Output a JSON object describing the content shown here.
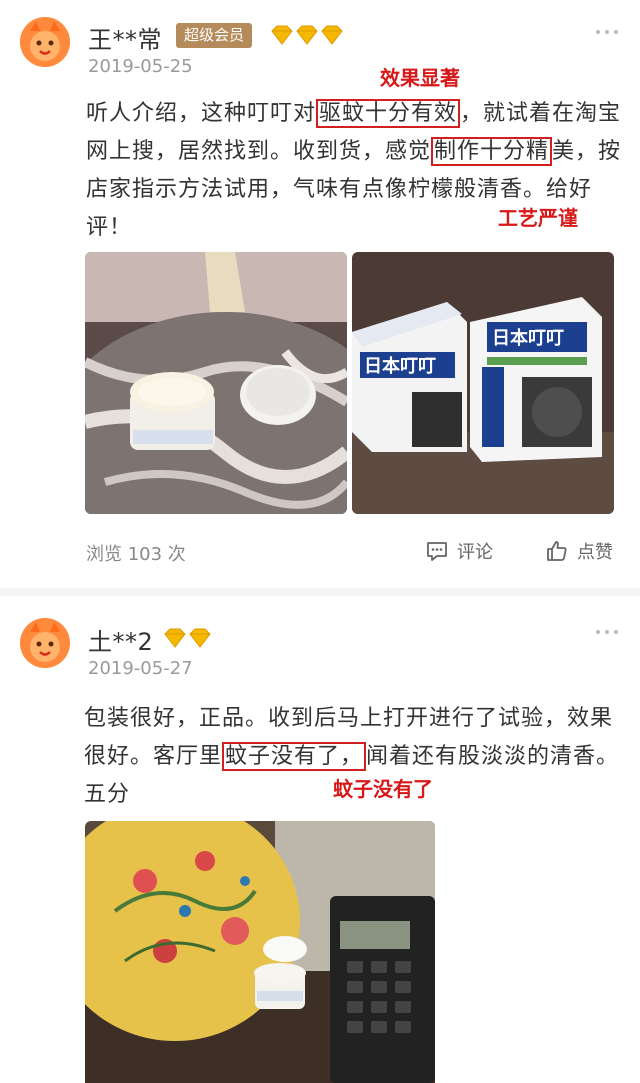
{
  "reviews": [
    {
      "username": "王**常",
      "vip_label": "超级会员",
      "diamond_icons": [
        "diamond-icon",
        "diamond-icon",
        "diamond-icon"
      ],
      "date": "2019-05-25",
      "text_parts": [
        "听人介绍，这种叮叮对",
        "驱蚊十分有效",
        "，就试着在淘宝网上搜，居然找到。收到货，感觉",
        "制作十分精",
        "美，按店家指示方法试用，气味有点像柠檬般清香。给好评！"
      ],
      "annotations": [
        "效果显著",
        "工艺严谨"
      ],
      "views": "浏览 103 次",
      "comment_label": "评论",
      "like_label": "点赞"
    },
    {
      "username": "土**2",
      "diamond_icons": [
        "diamond-icon",
        "diamond-icon"
      ],
      "date": "2019-05-27",
      "text_parts": [
        "包装很好，正品。收到后马上打开进行了试验，效果很好。客厅里",
        "蚊子没有了，",
        "闻着还有股淡淡的清香。五分"
      ],
      "annotations": [
        "蚊子没有了"
      ]
    }
  ],
  "product_box_label": "日本叮叮",
  "colors": {
    "annotation_red": "#d81818",
    "vip_badge": "#b58b5b",
    "diamond": "#f5b800",
    "avatar": "#ff8a3d"
  }
}
